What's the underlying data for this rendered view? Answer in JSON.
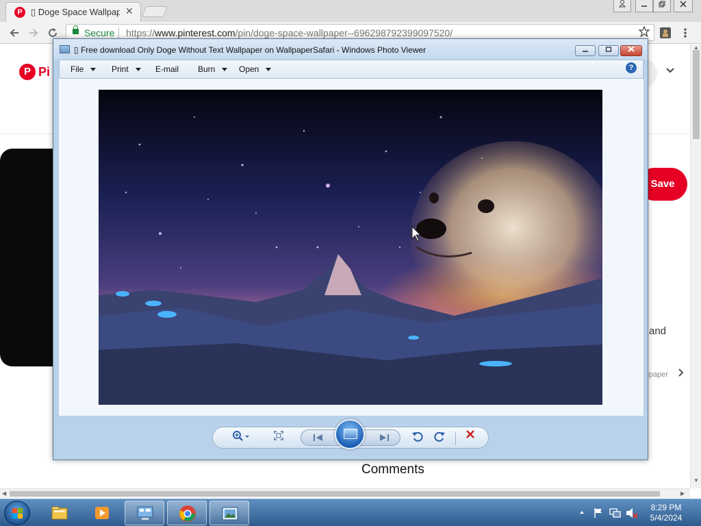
{
  "browser": {
    "tab": {
      "title": "▯ Doge Space Wallpaper",
      "close": "✕"
    },
    "window_buttons": {
      "user": "♟",
      "minimize": "—",
      "restore": "❐",
      "close": "✕"
    },
    "address": {
      "secure_label": "Secure",
      "url_scheme": "https://",
      "url_host": "www.pinterest.com",
      "url_path": "/pin/doge-space-wallpaper--696298792399097520/"
    },
    "icons": {
      "back": "back-arrow-icon",
      "forward": "forward-arrow-icon",
      "reload": "reload-icon",
      "star": "star-icon",
      "extension": "extension-icon",
      "menu": "menu-icon"
    }
  },
  "pinterest": {
    "logo_text": "Pi",
    "save_label": "Save",
    "side_text": "and",
    "side_chip": "llpaper",
    "comments_label": "Comments",
    "brand_color": "#e60023"
  },
  "viewer": {
    "title": "▯ Free download Only Doge Without Text Wallpaper on WallpaperSafari - Windows Photo Viewer",
    "menu": [
      {
        "label": "File",
        "dropdown": true
      },
      {
        "label": "Print",
        "dropdown": true
      },
      {
        "label": "E-mail",
        "dropdown": false
      },
      {
        "label": "Burn",
        "dropdown": true
      },
      {
        "label": "Open",
        "dropdown": true
      }
    ],
    "help": "?",
    "controls": {
      "zoom": "zoom-icon",
      "actual_size": "actual-size-icon",
      "previous": "previous-icon",
      "slideshow": "slideshow-icon",
      "next": "next-icon",
      "rotate_ccw": "rotate-counterclockwise-icon",
      "rotate_cw": "rotate-clockwise-icon",
      "delete": "delete-icon"
    }
  },
  "taskbar": {
    "apps": [
      "file-explorer-icon",
      "media-player-icon",
      "control-panel-icon",
      "chrome-icon",
      "photo-viewer-icon"
    ],
    "clock_time": "8:29 PM",
    "clock_date": "5/4/2024"
  }
}
